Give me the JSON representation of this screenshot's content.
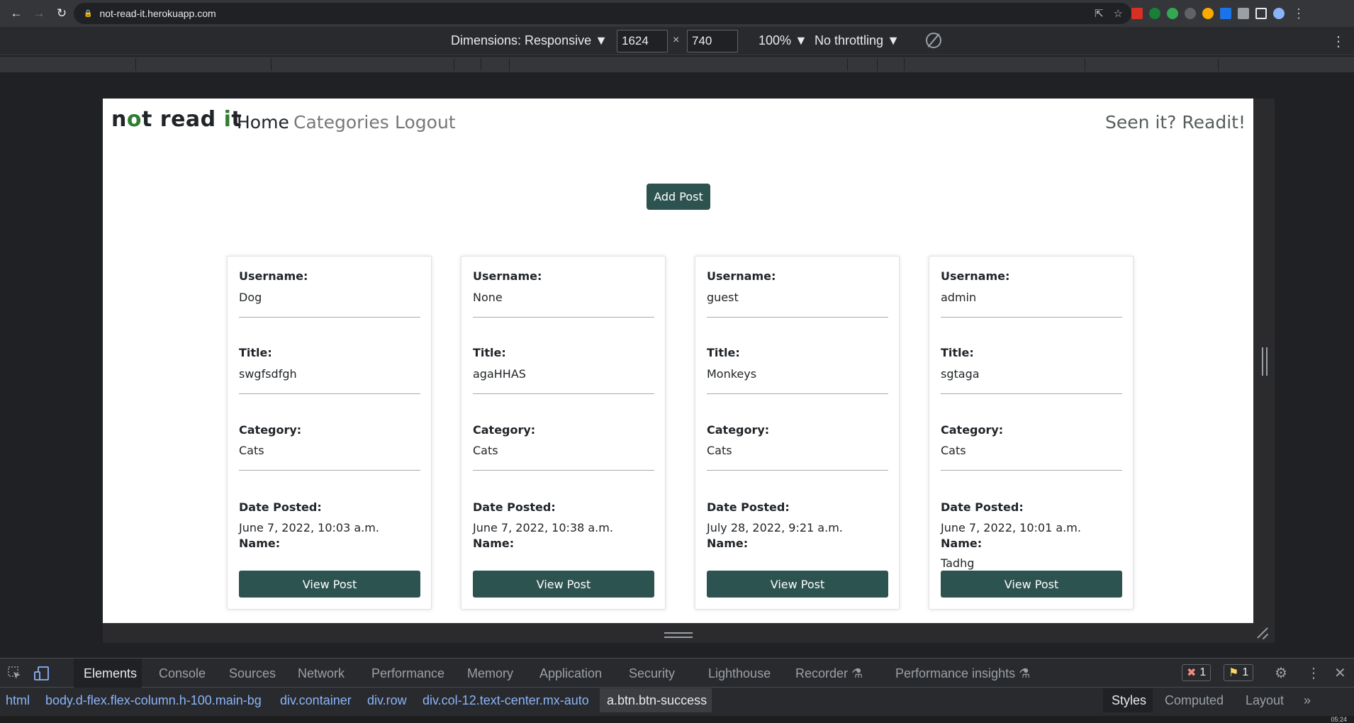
{
  "browser": {
    "url": "not-read-it.herokuapp.com",
    "back_icon": "arrow-left-icon",
    "forward_icon": "arrow-right-icon",
    "reload_icon": "reload-icon"
  },
  "device_toolbar": {
    "dimensions_label": "Dimensions: Responsive",
    "width": "1624",
    "height": "740",
    "x_sep": "×",
    "zoom": "100%",
    "throttling": "No throttling"
  },
  "site": {
    "brand": {
      "n": "n",
      "o": "o",
      "mid": "t read ",
      "i": "i",
      "t": "t"
    },
    "nav": {
      "home": "Home",
      "categories": "Categories",
      "logout": "Logout"
    },
    "tagline": "Seen it? Readit!",
    "add_post": "Add Post",
    "labels": {
      "username": "Username:",
      "title": "Title:",
      "category": "Category:",
      "date": "Date Posted:",
      "name": "Name:",
      "view": "View Post"
    },
    "posts": [
      {
        "username": "Dog",
        "title": "swgfsdfgh",
        "category": "Cats",
        "date": "June 7, 2022, 10:03 a.m.",
        "name": ""
      },
      {
        "username": "None",
        "title": "agaHHAS",
        "category": "Cats",
        "date": "June 7, 2022, 10:38 a.m.",
        "name": ""
      },
      {
        "username": "guest",
        "title": "Monkeys",
        "category": "Cats",
        "date": "July 28, 2022, 9:21 a.m.",
        "name": ""
      },
      {
        "username": "admin",
        "title": "sgtaga",
        "category": "Cats",
        "date": "June 7, 2022, 10:01 a.m.",
        "name": "Tadhg"
      }
    ]
  },
  "devtools": {
    "tabs": [
      "Elements",
      "Console",
      "Sources",
      "Network",
      "Performance",
      "Memory",
      "Application",
      "Security",
      "Lighthouse",
      "Recorder",
      "Performance insights"
    ],
    "errors": "1",
    "warnings": "1",
    "breadcrumbs": [
      "html",
      "body.d-flex.flex-column.h-100.main-bg",
      "div.container",
      "div.row",
      "div.col-12.text-center.mx-auto",
      "a.btn.btn-success"
    ],
    "side_tabs": [
      "Styles",
      "Computed",
      "Layout"
    ],
    "more": "»"
  },
  "clock": "05:24",
  "colors": {
    "brand_green": "#2d5351",
    "accent_letter": "#2e7d32"
  }
}
